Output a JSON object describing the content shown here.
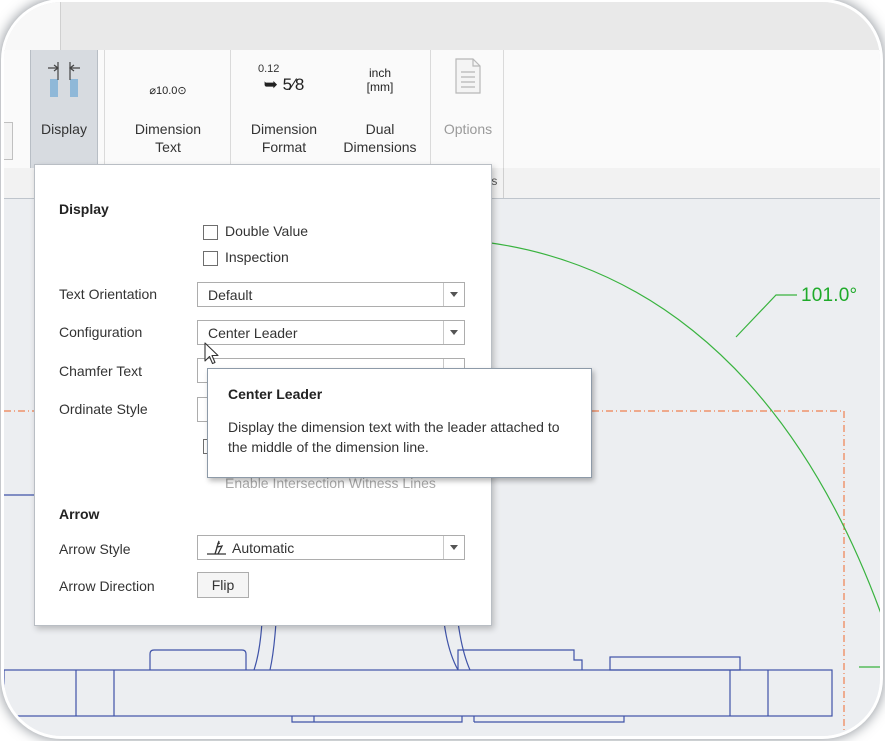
{
  "ribbon": {
    "display_label": "Display",
    "dimension_text_label": "Dimension\nText",
    "dimension_text_icon_value": "⌀10.0⊙",
    "dimension_format_label": "Dimension\nFormat",
    "dimension_format_icon_top": "0.12",
    "dimension_format_icon_bottom": "➥ 5⁄8",
    "dual_dimensions_label": "Dual\nDimensions",
    "dual_dimensions_icon_top": "inch",
    "dual_dimensions_icon_bottom": "[mm]",
    "options_label": "Options",
    "group_label_fragment": "ıs"
  },
  "panel": {
    "display_header": "Display",
    "double_value_label": "Double Value",
    "double_value_checked": false,
    "inspection_label": "Inspection",
    "inspection_checked": false,
    "text_orientation_label": "Text Orientation",
    "text_orientation_value": "Default",
    "configuration_label": "Configuration",
    "configuration_value": "Center Leader",
    "chamfer_text_label": "Chamfer Text",
    "ordinate_style_label": "Ordinate Style",
    "enable_intersection_label": "Enable Intersection Witness Lines",
    "arrow_header": "Arrow",
    "arrow_style_label": "Arrow Style",
    "arrow_style_value": "Automatic",
    "arrow_direction_label": "Arrow Direction",
    "flip_label": "Flip"
  },
  "tooltip": {
    "title": "Center Leader",
    "description": "Display the dimension text with the leader attached to the middle of the dimension line."
  },
  "canvas": {
    "dimension_value": "101.0°"
  },
  "colors": {
    "dimension_green": "#1faa2a",
    "drawing_blue": "#3f53a8",
    "reference_orange": "#f08050",
    "ribbon_selected": "#d7dbe0"
  }
}
